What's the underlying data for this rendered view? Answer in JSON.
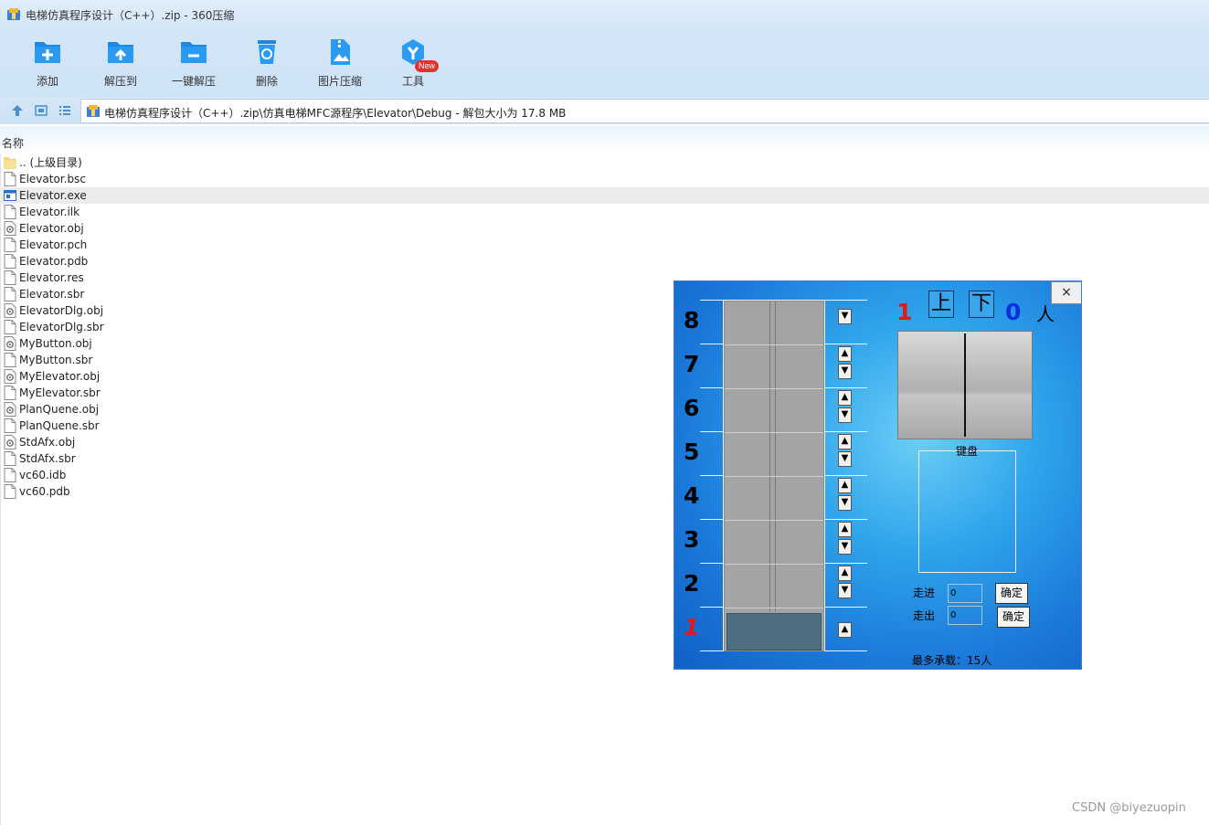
{
  "window": {
    "title": "电梯仿真程序设计（C++）.zip - 360压缩"
  },
  "toolbar": {
    "items": [
      {
        "label": "添加",
        "icon": "add-folder-icon"
      },
      {
        "label": "解压到",
        "icon": "extract-to-icon"
      },
      {
        "label": "一键解压",
        "icon": "one-click-extract-icon"
      },
      {
        "label": "删除",
        "icon": "trash-icon"
      },
      {
        "label": "图片压缩",
        "icon": "image-compress-icon"
      },
      {
        "label": "工具",
        "icon": "tools-icon"
      }
    ],
    "badge": "New"
  },
  "address": {
    "path": "电梯仿真程序设计（C++）.zip\\仿真电梯MFC源程序\\Elevator\\Debug - 解包大小为 17.8 MB"
  },
  "list": {
    "column_name": "名称",
    "files": [
      {
        "name": ".. (上级目录)",
        "type": "folder"
      },
      {
        "name": "Elevator.bsc",
        "type": "file"
      },
      {
        "name": "Elevator.exe",
        "type": "exe"
      },
      {
        "name": "Elevator.ilk",
        "type": "file"
      },
      {
        "name": "Elevator.obj",
        "type": "obj"
      },
      {
        "name": "Elevator.pch",
        "type": "file"
      },
      {
        "name": "Elevator.pdb",
        "type": "file"
      },
      {
        "name": "Elevator.res",
        "type": "file"
      },
      {
        "name": "Elevator.sbr",
        "type": "file"
      },
      {
        "name": "ElevatorDlg.obj",
        "type": "obj"
      },
      {
        "name": "ElevatorDlg.sbr",
        "type": "file"
      },
      {
        "name": "MyButton.obj",
        "type": "obj"
      },
      {
        "name": "MyButton.sbr",
        "type": "file"
      },
      {
        "name": "MyElevator.obj",
        "type": "obj"
      },
      {
        "name": "MyElevator.sbr",
        "type": "file"
      },
      {
        "name": "PlanQuene.obj",
        "type": "obj"
      },
      {
        "name": "PlanQuene.sbr",
        "type": "file"
      },
      {
        "name": "StdAfx.obj",
        "type": "obj"
      },
      {
        "name": "StdAfx.sbr",
        "type": "file"
      },
      {
        "name": "vc60.idb",
        "type": "file"
      },
      {
        "name": "vc60.pdb",
        "type": "file"
      }
    ],
    "selected_index": 2
  },
  "elevator_app": {
    "close_label": "×",
    "floors": [
      "8",
      "7",
      "6",
      "5",
      "4",
      "3",
      "2",
      "1"
    ],
    "current_floor_marker": "1",
    "status_floor": "1",
    "dir_up": "上",
    "dir_down": "下",
    "status_count": "0",
    "status_unit": "人",
    "keypad_title": "键盘",
    "enter_label": "走进",
    "exit_label": "走出",
    "enter_value": "0",
    "exit_value": "0",
    "ok_label": "确定",
    "max_load": "最多承载：15人",
    "colors": {
      "current_floor": "#e01818",
      "count": "#0a2ee0",
      "cabin": "#4e6f7f"
    }
  },
  "watermark": "CSDN @biyezuopin"
}
